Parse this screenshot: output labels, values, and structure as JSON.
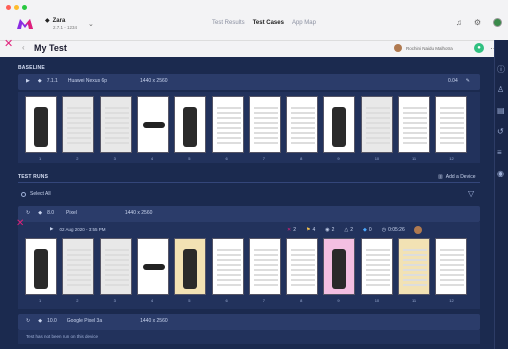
{
  "colors": {
    "accent": "#e0207a",
    "bg": "#1b2a4f",
    "panel": "#2b3c6a",
    "info": "#4aa8ff"
  },
  "project": {
    "name": "Zara",
    "version": "2.7.1 - 1234"
  },
  "nav": [
    "Test Results",
    "Test Cases",
    "App Map"
  ],
  "nav_active": "Test Cases",
  "page": {
    "title": "My Test",
    "user": "Rochini Naidu Malhotra"
  },
  "baseline": {
    "label": "BASELINE",
    "os_version": "7.1.1",
    "device": "Huawei Nexus 6p",
    "resolution": "1440 x 2560",
    "duration": "0.04",
    "frames": [
      "1",
      "2",
      "3",
      "4",
      "5",
      "6",
      "7",
      "8",
      "9",
      "10",
      "11",
      "12"
    ]
  },
  "test_runs": {
    "label": "TEST RUNS",
    "add_device": "Add a Device",
    "select_all": "Select All",
    "runs": [
      {
        "os_version": "8.0",
        "device": "Pixel",
        "resolution": "1440 x 2560",
        "date": "02 Aug 2020 - 3:55 PM",
        "stats": {
          "failed": "2",
          "flagged": "4",
          "viewed": "2",
          "warnings": "2",
          "info": "0",
          "time": "0:05:26"
        },
        "frames": [
          "1",
          "2",
          "3",
          "4",
          "5",
          "6",
          "7",
          "8",
          "9",
          "10",
          "11",
          "12"
        ]
      },
      {
        "os_version": "10.0",
        "device": "Google Pixel 3a",
        "resolution": "1440 x 2560",
        "note": "Test has not been run on this device"
      }
    ]
  }
}
